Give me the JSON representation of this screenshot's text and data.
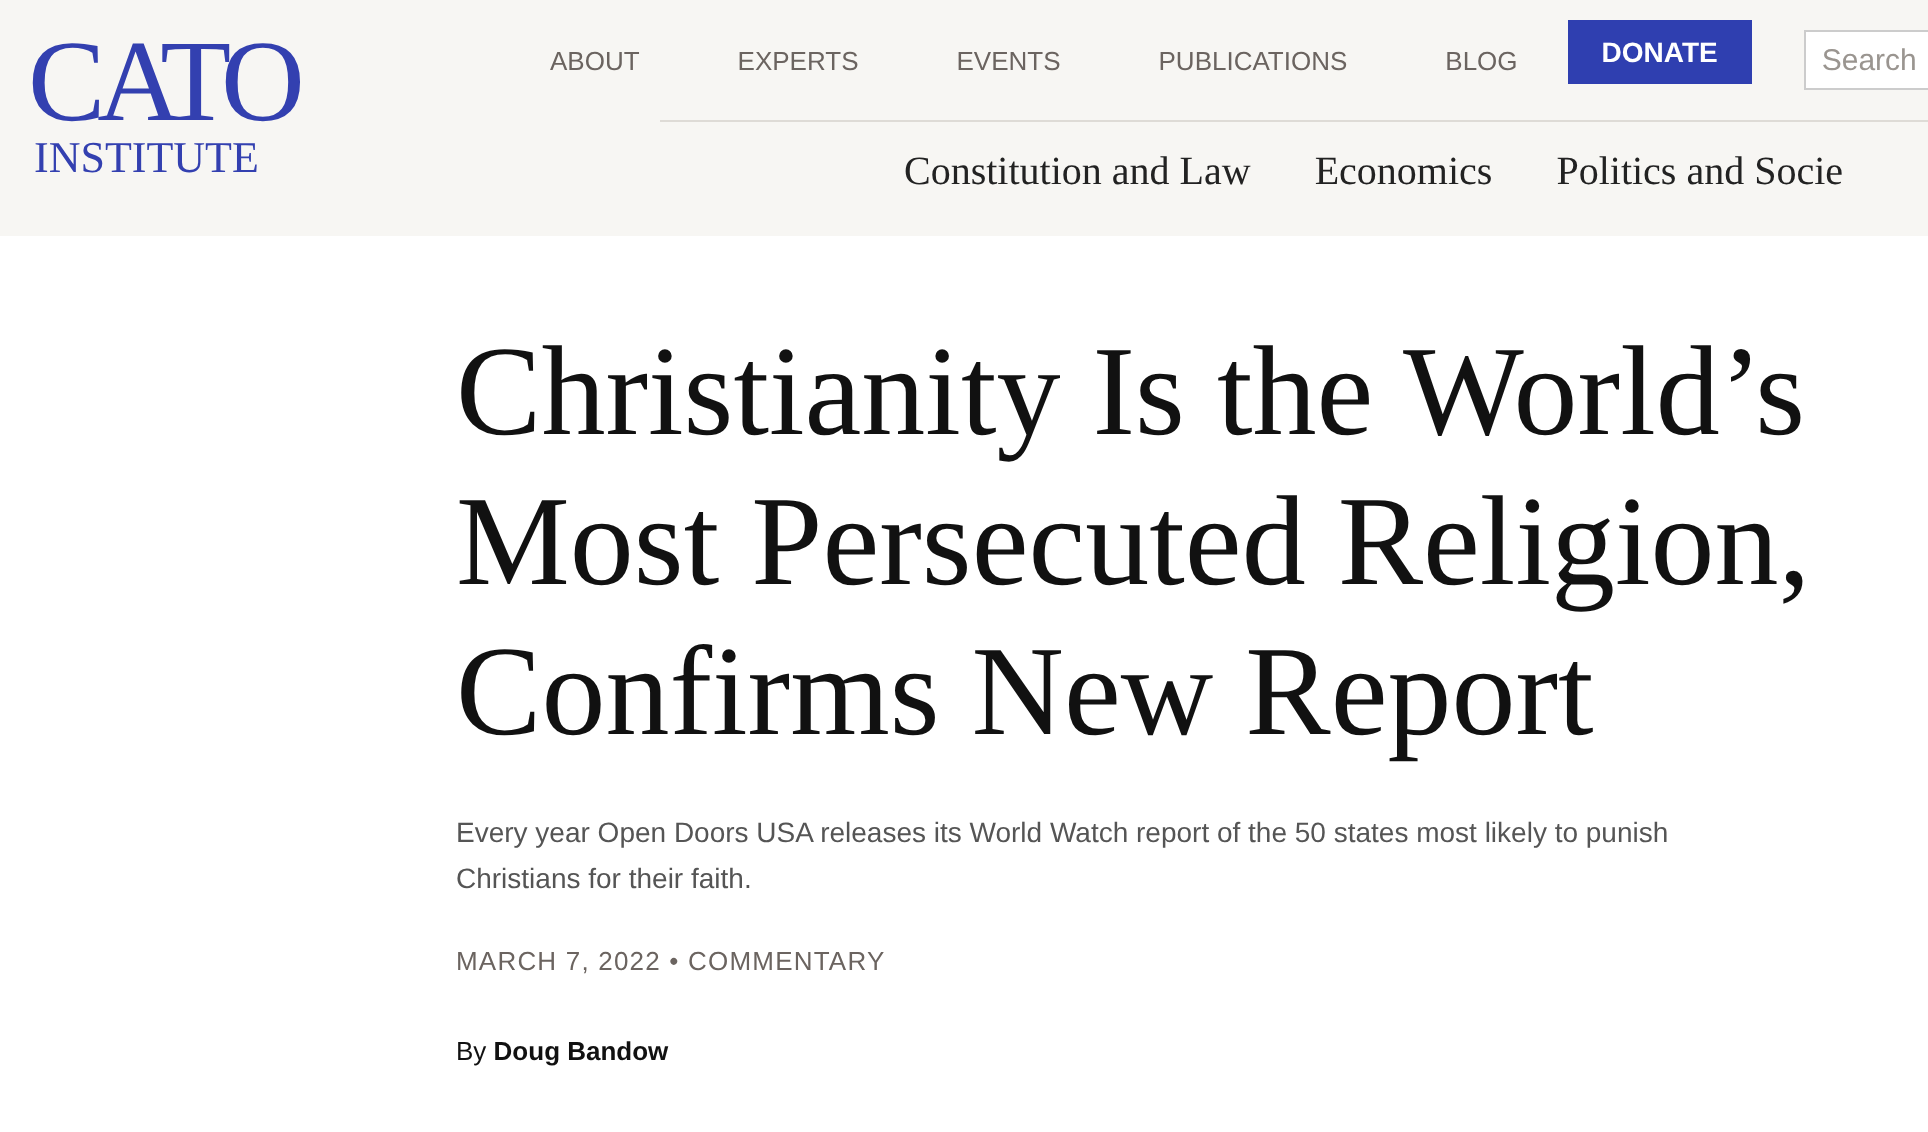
{
  "logo": {
    "word": "CATO",
    "subtitle": "INSTITUTE"
  },
  "top_nav": [
    {
      "label": "ABOUT",
      "kind": "link"
    },
    {
      "label": "EXPERTS",
      "kind": "link"
    },
    {
      "label": "EVENTS",
      "kind": "link"
    },
    {
      "label": "PUBLICATIONS",
      "kind": "link"
    },
    {
      "label": "BLOG",
      "kind": "link"
    },
    {
      "label": "DONATE",
      "kind": "button"
    }
  ],
  "search": {
    "placeholder": "Search"
  },
  "categories": [
    "Constitution and Law",
    "Economics",
    "Politics and Socie"
  ],
  "article": {
    "title_lines": [
      "Christianity Is the World’s",
      "Most Persecuted Religion,",
      "Confirms New Report"
    ],
    "summary": "Every year Open Doors USA releases its World Watch report of the 50 states most likely to punish Christians for their faith.",
    "dateline": "MARCH 7, 2022 • COMMENTARY",
    "byline": "By **Doug Bandow**"
  }
}
